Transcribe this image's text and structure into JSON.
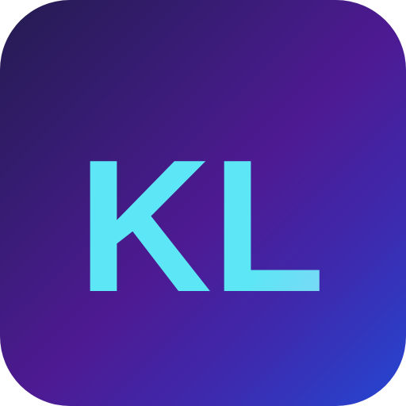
{
  "icon": {
    "monogram": "KL",
    "colors": {
      "gradient_start": "#241c50",
      "gradient_mid": "#4e1a92",
      "gradient_end": "#2447d2",
      "letter_color": "#5de6f5",
      "letter_highlight": "#7ad8f5"
    }
  }
}
